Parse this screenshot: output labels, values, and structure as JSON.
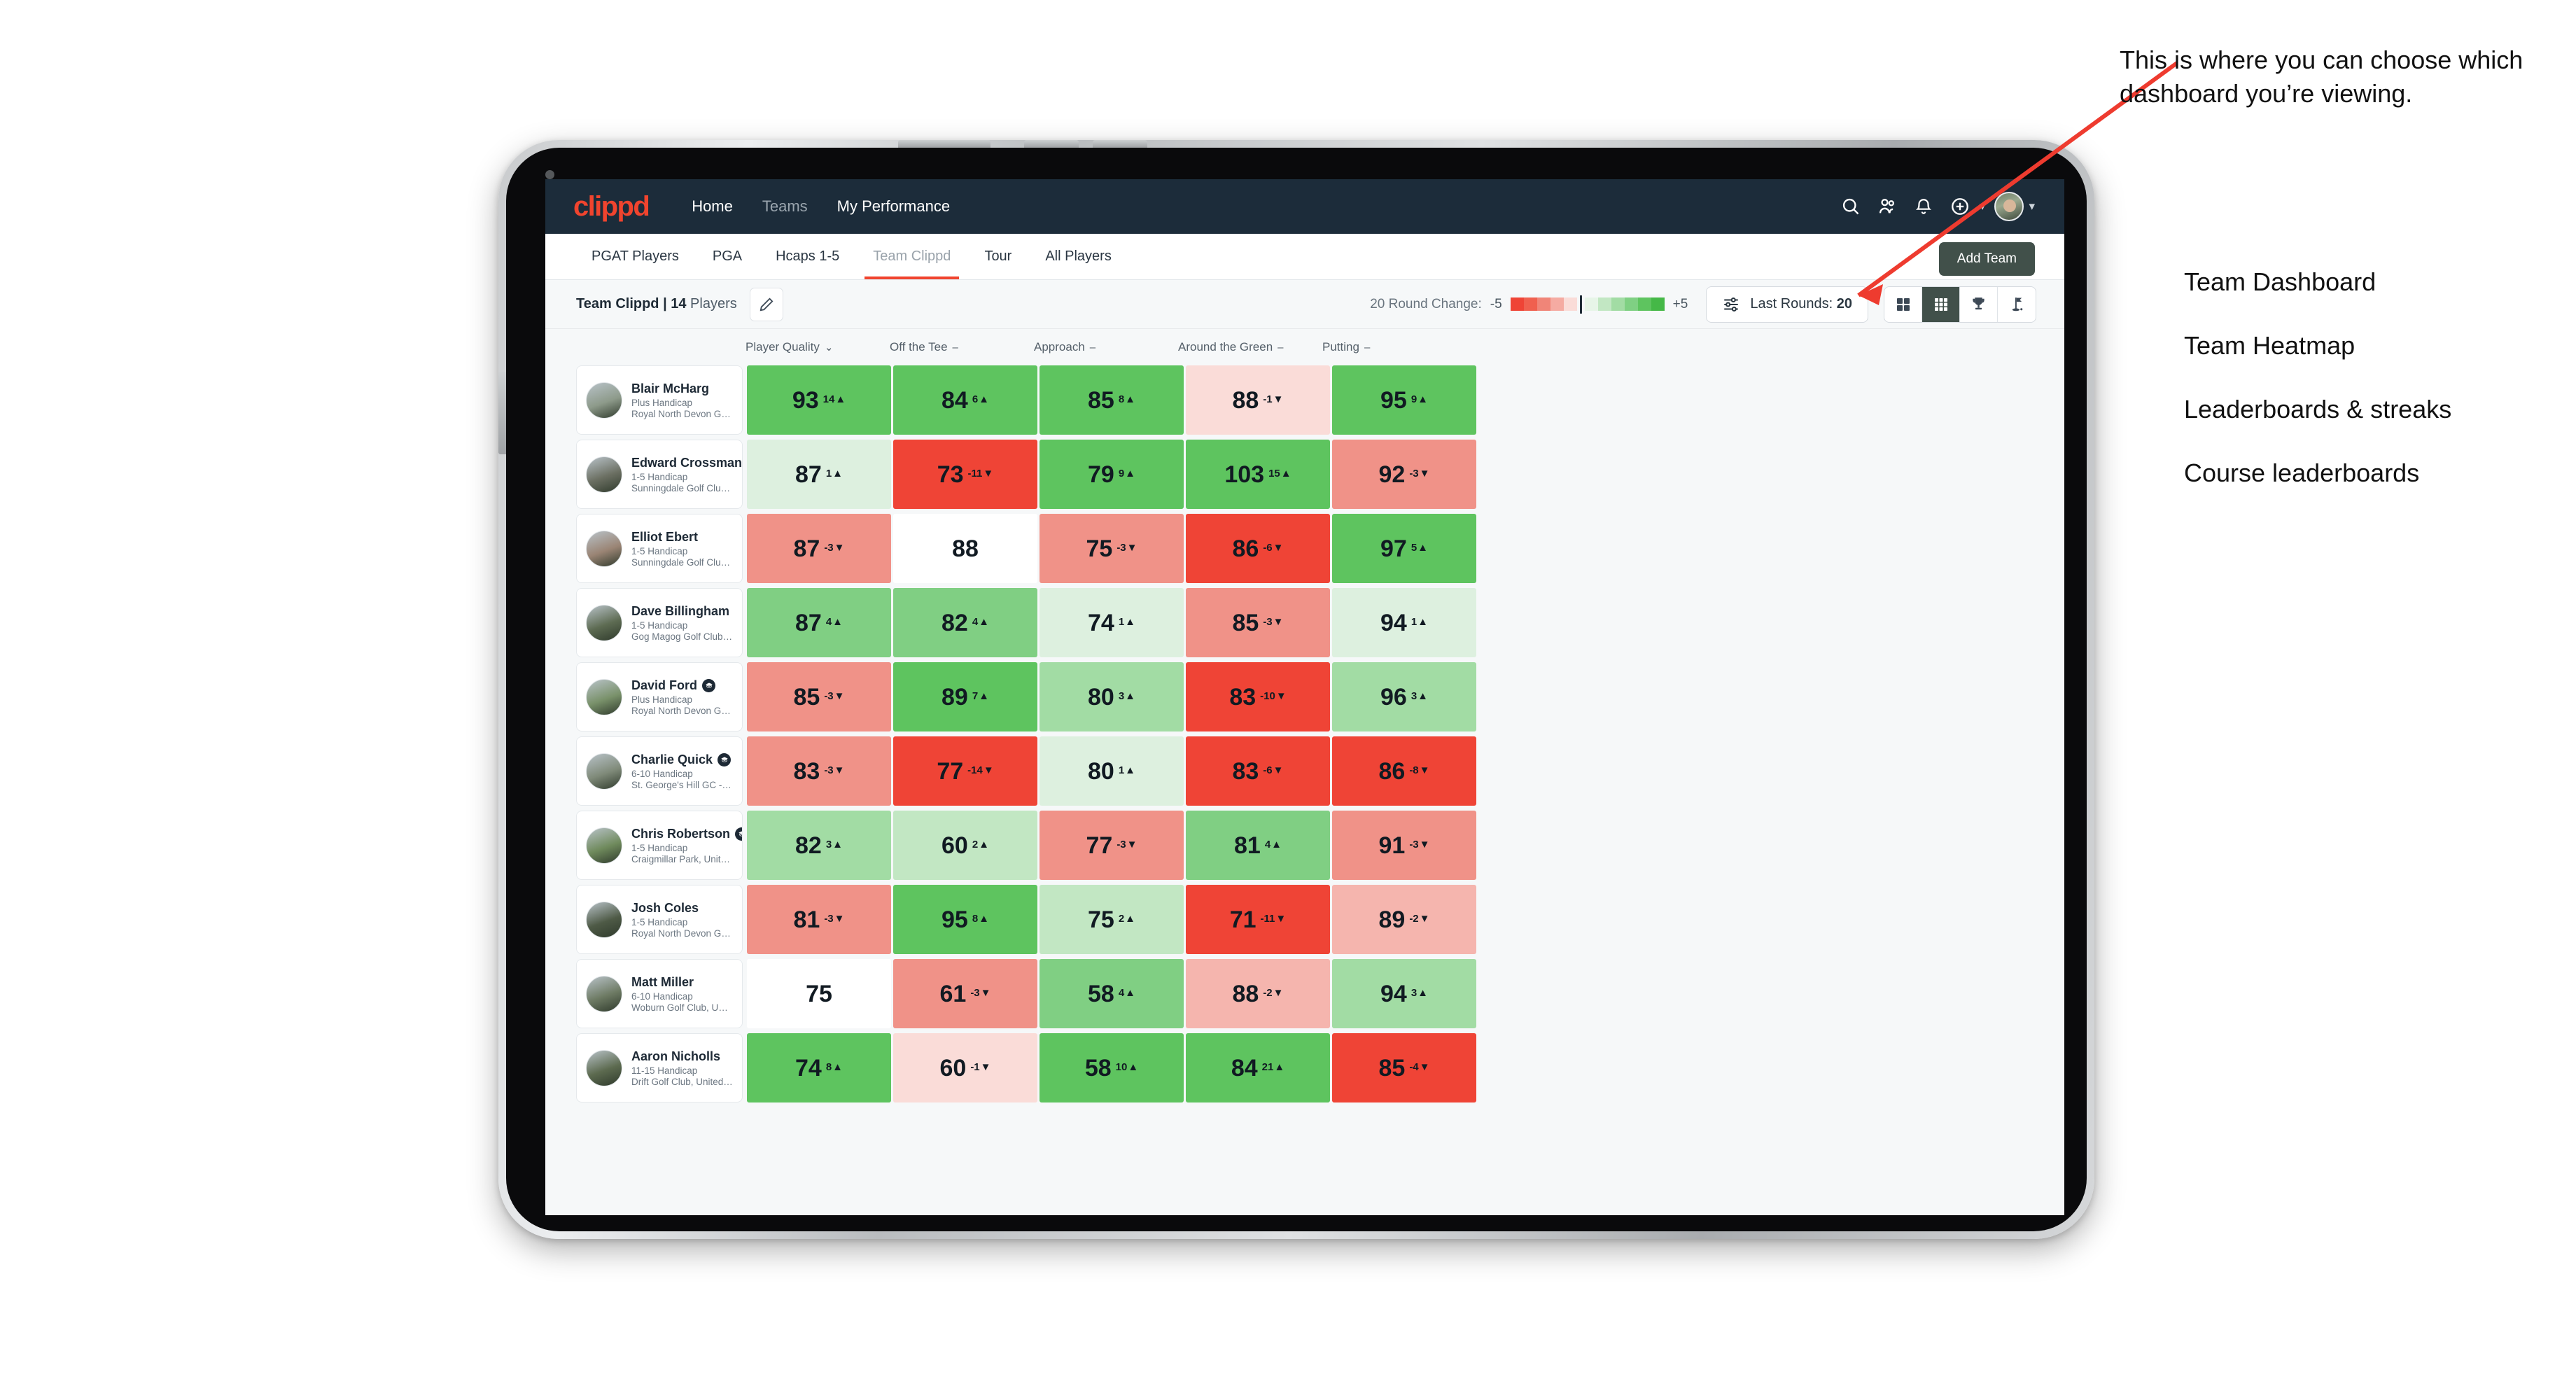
{
  "navbar": {
    "brand": "clippd",
    "links": [
      {
        "label": "Home",
        "dim": false
      },
      {
        "label": "Teams",
        "dim": true
      },
      {
        "label": "My Performance",
        "dim": false
      }
    ],
    "icons": [
      "search-icon",
      "people-icon",
      "bell-icon",
      "plus-circle-icon",
      "avatar"
    ]
  },
  "tabs": [
    {
      "label": "PGAT Players",
      "active": false
    },
    {
      "label": "PGA",
      "active": false
    },
    {
      "label": "Hcaps 1-5",
      "active": false
    },
    {
      "label": "Team Clippd",
      "active": true
    },
    {
      "label": "Tour",
      "active": false
    },
    {
      "label": "All Players",
      "active": false
    }
  ],
  "add_team_label": "Add Team",
  "toolbar": {
    "team_name": "Team Clippd",
    "team_separator": " | ",
    "team_count": "14",
    "team_count_suffix": " Players",
    "edit_icon": "pencil-icon",
    "legend_label": "20 Round Change:",
    "legend_min": "-5",
    "legend_max": "+5",
    "rounds_label": "Last Rounds:",
    "rounds_value": "20",
    "views": [
      {
        "name": "team-dashboard",
        "icon": "grid-4-icon",
        "active": false
      },
      {
        "name": "team-heatmap",
        "icon": "grid-9-icon",
        "active": true
      },
      {
        "name": "leaderboards-streaks",
        "icon": "trophy-icon",
        "active": false
      },
      {
        "name": "course-leaderboards",
        "icon": "golf-flag-icon",
        "active": false
      }
    ]
  },
  "columns": [
    {
      "label": "Player Quality",
      "mark": "caret"
    },
    {
      "label": "Off the Tee",
      "mark": "dash"
    },
    {
      "label": "Approach",
      "mark": "dash"
    },
    {
      "label": "Around the Green",
      "mark": "dash"
    },
    {
      "label": "Putting",
      "mark": "dash"
    }
  ],
  "players": [
    {
      "name": "Blair McHarg",
      "badge": false,
      "handicap": "Plus Handicap",
      "club": "Royal North Devon Golf Club, United Kingdom",
      "avatar": "#8d9a8a",
      "cells": [
        {
          "value": "93",
          "delta": "14",
          "dir": "up",
          "color": "#5ec45f"
        },
        {
          "value": "84",
          "delta": "6",
          "dir": "up",
          "color": "#5ec45f"
        },
        {
          "value": "85",
          "delta": "8",
          "dir": "up",
          "color": "#5ec45f"
        },
        {
          "value": "88",
          "delta": "-1",
          "dir": "down",
          "color": "#fadcd8"
        },
        {
          "value": "95",
          "delta": "9",
          "dir": "up",
          "color": "#5ec45f"
        }
      ]
    },
    {
      "name": "Edward Crossman",
      "badge": false,
      "handicap": "1-5 Handicap",
      "club": "Sunningdale Golf Club, United Kingdom",
      "avatar": "#6b6f62",
      "cells": [
        {
          "value": "87",
          "delta": "1",
          "dir": "up",
          "color": "#ddf0df"
        },
        {
          "value": "73",
          "delta": "-11",
          "dir": "down",
          "color": "#ef4436"
        },
        {
          "value": "79",
          "delta": "9",
          "dir": "up",
          "color": "#5ec45f"
        },
        {
          "value": "103",
          "delta": "15",
          "dir": "up",
          "color": "#5ec45f"
        },
        {
          "value": "92",
          "delta": "-3",
          "dir": "down",
          "color": "#f09288"
        }
      ]
    },
    {
      "name": "Elliot Ebert",
      "badge": false,
      "handicap": "1-5 Handicap",
      "club": "Sunningdale Golf Club, United Kingdom",
      "avatar": "#9a8474",
      "cells": [
        {
          "value": "87",
          "delta": "-3",
          "dir": "down",
          "color": "#f09288"
        },
        {
          "value": "88",
          "delta": "",
          "dir": "",
          "color": "#ffffff"
        },
        {
          "value": "75",
          "delta": "-3",
          "dir": "down",
          "color": "#f09288"
        },
        {
          "value": "86",
          "delta": "-6",
          "dir": "down",
          "color": "#ef4436"
        },
        {
          "value": "97",
          "delta": "5",
          "dir": "up",
          "color": "#5ec45f"
        }
      ]
    },
    {
      "name": "Dave Billingham",
      "badge": false,
      "handicap": "1-5 Handicap",
      "club": "Gog Magog Golf Club, United Kingdom",
      "avatar": "#5d6b52",
      "cells": [
        {
          "value": "87",
          "delta": "4",
          "dir": "up",
          "color": "#80cf83"
        },
        {
          "value": "82",
          "delta": "4",
          "dir": "up",
          "color": "#80cf83"
        },
        {
          "value": "74",
          "delta": "1",
          "dir": "up",
          "color": "#ddf0df"
        },
        {
          "value": "85",
          "delta": "-3",
          "dir": "down",
          "color": "#f09288"
        },
        {
          "value": "94",
          "delta": "1",
          "dir": "up",
          "color": "#ddf0df"
        }
      ]
    },
    {
      "name": "David Ford",
      "badge": true,
      "handicap": "Plus Handicap",
      "club": "Royal North Devon Golf Club, United Kingdom",
      "avatar": "#79916a",
      "cells": [
        {
          "value": "85",
          "delta": "-3",
          "dir": "down",
          "color": "#f09288"
        },
        {
          "value": "89",
          "delta": "7",
          "dir": "up",
          "color": "#5ec45f"
        },
        {
          "value": "80",
          "delta": "3",
          "dir": "up",
          "color": "#a2dca4"
        },
        {
          "value": "83",
          "delta": "-10",
          "dir": "down",
          "color": "#ef4436"
        },
        {
          "value": "96",
          "delta": "3",
          "dir": "up",
          "color": "#a2dca4"
        }
      ]
    },
    {
      "name": "Charlie Quick",
      "badge": true,
      "handicap": "6-10 Handicap",
      "club": "St. George's Hill GC - Weybridge - Surrey, Uni...",
      "avatar": "#7f8a79",
      "cells": [
        {
          "value": "83",
          "delta": "-3",
          "dir": "down",
          "color": "#f09288"
        },
        {
          "value": "77",
          "delta": "-14",
          "dir": "down",
          "color": "#ef4436"
        },
        {
          "value": "80",
          "delta": "1",
          "dir": "up",
          "color": "#ddf0df"
        },
        {
          "value": "83",
          "delta": "-6",
          "dir": "down",
          "color": "#ef4436"
        },
        {
          "value": "86",
          "delta": "-8",
          "dir": "down",
          "color": "#ef4436"
        }
      ]
    },
    {
      "name": "Chris Robertson",
      "badge": true,
      "handicap": "1-5 Handicap",
      "club": "Craigmillar Park, United Kingdom",
      "avatar": "#6f8a5c",
      "cells": [
        {
          "value": "82",
          "delta": "3",
          "dir": "up",
          "color": "#a2dca4"
        },
        {
          "value": "60",
          "delta": "2",
          "dir": "up",
          "color": "#c2e7c3"
        },
        {
          "value": "77",
          "delta": "-3",
          "dir": "down",
          "color": "#f09288"
        },
        {
          "value": "81",
          "delta": "4",
          "dir": "up",
          "color": "#80cf83"
        },
        {
          "value": "91",
          "delta": "-3",
          "dir": "down",
          "color": "#f09288"
        }
      ]
    },
    {
      "name": "Josh Coles",
      "badge": false,
      "handicap": "1-5 Handicap",
      "club": "Royal North Devon Golf Club, United Kingdom",
      "avatar": "#4e5a46",
      "cells": [
        {
          "value": "81",
          "delta": "-3",
          "dir": "down",
          "color": "#f09288"
        },
        {
          "value": "95",
          "delta": "8",
          "dir": "up",
          "color": "#5ec45f"
        },
        {
          "value": "75",
          "delta": "2",
          "dir": "up",
          "color": "#c2e7c3"
        },
        {
          "value": "71",
          "delta": "-11",
          "dir": "down",
          "color": "#ef4436"
        },
        {
          "value": "89",
          "delta": "-2",
          "dir": "down",
          "color": "#f5b5ae"
        }
      ]
    },
    {
      "name": "Matt Miller",
      "badge": false,
      "handicap": "6-10 Handicap",
      "club": "Woburn Golf Club, United Kingdom",
      "avatar": "#6d7a63",
      "cells": [
        {
          "value": "75",
          "delta": "",
          "dir": "",
          "color": "#ffffff"
        },
        {
          "value": "61",
          "delta": "-3",
          "dir": "down",
          "color": "#f09288"
        },
        {
          "value": "58",
          "delta": "4",
          "dir": "up",
          "color": "#80cf83"
        },
        {
          "value": "88",
          "delta": "-2",
          "dir": "down",
          "color": "#f5b5ae"
        },
        {
          "value": "94",
          "delta": "3",
          "dir": "up",
          "color": "#a2dca4"
        }
      ]
    },
    {
      "name": "Aaron Nicholls",
      "badge": false,
      "handicap": "11-15 Handicap",
      "club": "Drift Golf Club, United Kingdom",
      "avatar": "#5c6a4f",
      "cells": [
        {
          "value": "74",
          "delta": "8",
          "dir": "up",
          "color": "#5ec45f"
        },
        {
          "value": "60",
          "delta": "-1",
          "dir": "down",
          "color": "#fadcd8"
        },
        {
          "value": "58",
          "delta": "10",
          "dir": "up",
          "color": "#5ec45f"
        },
        {
          "value": "84",
          "delta": "21",
          "dir": "up",
          "color": "#5ec45f"
        },
        {
          "value": "85",
          "delta": "-4",
          "dir": "down",
          "color": "#ef4436"
        }
      ]
    }
  ],
  "annotation": {
    "callout": "This is where you can choose which dashboard you’re viewing.",
    "items": [
      "Team Dashboard",
      "Team Heatmap",
      "Leaderboards & streaks",
      "Course leaderboards"
    ],
    "arrow_color": "#ee3b2f"
  },
  "legend_colors": [
    "#ef4436",
    "#f0604f",
    "#f08578",
    "#f5aba2",
    "#fadcd8",
    "#e7f5e8",
    "#c2e7c3",
    "#a2dca4",
    "#7fd083",
    "#5ec45f",
    "#45b847"
  ]
}
